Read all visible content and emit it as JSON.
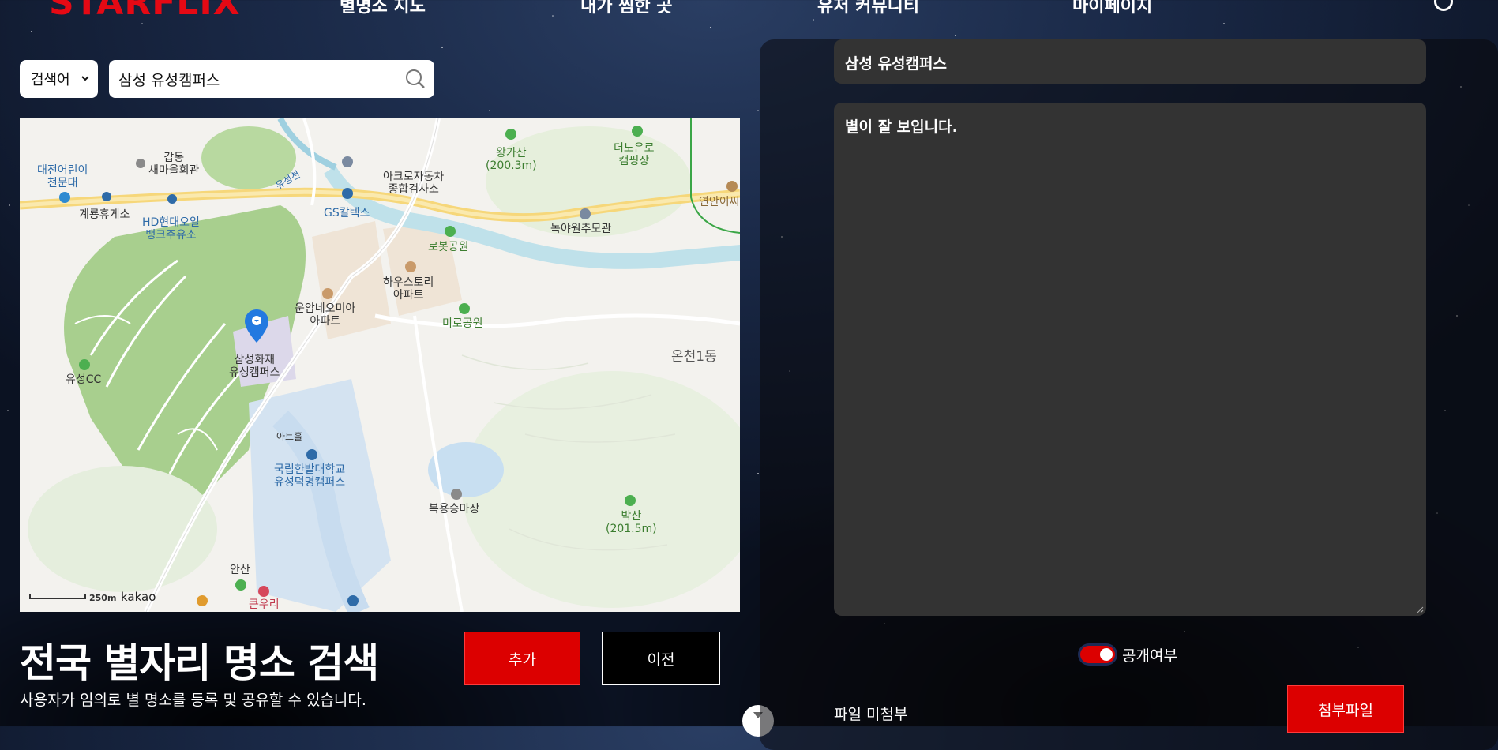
{
  "header": {
    "logo": "STARFLIX",
    "nav": [
      "별명소 지도",
      "내가 찜한 곳",
      "유저 커뮤니티",
      "마이페이지"
    ]
  },
  "search": {
    "select_value": "검색어",
    "query": "삼성 유성캠퍼스"
  },
  "map": {
    "labels": {
      "gapdong": "갑동\n새마을회관",
      "childpark": "대전어린이\n천문대",
      "rest": "계룡휴게소",
      "hd": "HD현대오일\n뱅크주유소",
      "yuseongcheon": "유성천",
      "gs": "GS칼텍스",
      "acro": "아크로자동차\n종합검사소",
      "wanggasan": "왕가산\n(200.3m)",
      "camping": "더노은로\n캠핑장",
      "yeonan": "연안이씨",
      "noya": "녹야원추모관",
      "robot": "로봇공원",
      "house": "하우스토리\n아파트",
      "unam": "운암네오미아\n아파트",
      "miro": "미로공원",
      "samsung": "삼성화재\n유성캠퍼스",
      "yuseongcc": "유성CC",
      "oncheon": "온천1동",
      "art": "아트홀",
      "hanbat": "국립한밭대학교\n유성덕명캠퍼스",
      "bokyong": "복용승마장",
      "baksan": "박산\n(201.5m)",
      "ansan": "안산",
      "keuri": "큰우리",
      "scale": "250m",
      "brand": "kakao"
    }
  },
  "page": {
    "title": "전국 별자리 명소 검색",
    "subtitle": "사용자가 임의로 별 명소를 등록 및 공유할 수 있습니다."
  },
  "buttons": {
    "add": "추가",
    "prev": "이전",
    "attach": "첨부파일"
  },
  "form": {
    "title_value": "삼성 유성캠퍼스",
    "content_value": "별이 잘 보입니다.",
    "public_label": "공개여부",
    "public_on": true,
    "file_status": "파일 미첨부"
  },
  "colors": {
    "accent": "#dc0000",
    "panel_field": "#333333"
  }
}
